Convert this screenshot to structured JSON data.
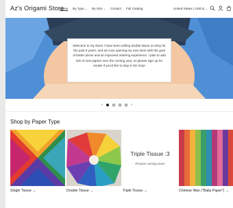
{
  "header": {
    "store_name": "Az's Origami Store",
    "nav": [
      {
        "label": "Home",
        "active": true
      },
      {
        "label": "By Type",
        "caret": "⌄"
      },
      {
        "label": "By Size",
        "caret": "⌄"
      },
      {
        "label": "Contact"
      },
      {
        "label": "Full Catalog"
      }
    ],
    "currency": "United States | USD $ ⌄",
    "icons": [
      "search-icon",
      "account-icon",
      "cart-icon"
    ]
  },
  "hero": {
    "message": "Welcome to my store! I have been selling double tissue on Etsy for the past 5 years, and am now opening my own store with the goal of better prices and an improved ordering experience. I plan to add lots of new papers over the coming year, so please sign up for emails if you'd like to stay in the loop!",
    "background_color": "#4f8fd6"
  },
  "slideshow": {
    "prev": "‹",
    "next": "›",
    "count": 4,
    "current": 1
  },
  "collections": {
    "title": "Shop by Paper Type",
    "items": [
      {
        "label": "Single Tissue →"
      },
      {
        "label": "Double Tissue →"
      },
      {
        "label": "Triple Tissue →",
        "placeholder_title": "Triple Tissue :3",
        "placeholder_sub": "Pictures coming soon!"
      },
      {
        "label": "Chinese Wax (\"Baby Paper\") →"
      }
    ]
  }
}
